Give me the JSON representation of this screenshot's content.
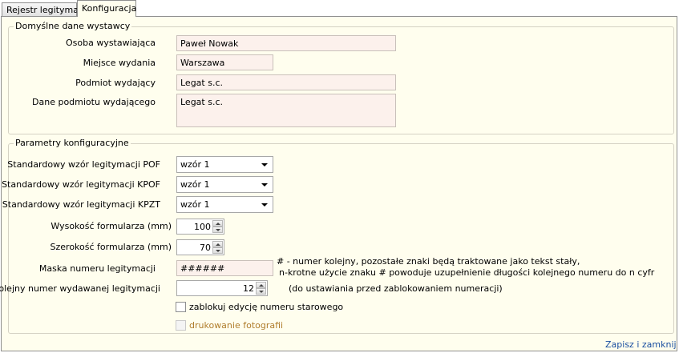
{
  "tabs": [
    {
      "label": "Rejestr legitymacji",
      "active": false
    },
    {
      "label": "Konfiguracja",
      "active": true
    }
  ],
  "issuer": {
    "legend": "Domyślne dane wystawcy",
    "person_label": "Osoba wystawiająca",
    "person_value": "Paweł Nowak",
    "place_label": "Miejsce wydania",
    "place_value": "Warszawa",
    "entity_label": "Podmiot wydający",
    "entity_value": "Legat s.c.",
    "entity_data_label": "Dane podmiotu wydającego",
    "entity_data_value": "Legat s.c."
  },
  "config": {
    "legend": "Parametry konfiguracyjne",
    "pof_label": "Standardowy wzór legitymacji POF",
    "pof_value": "wzór 1",
    "kpof_label": "Standardowy wzór legitymacji KPOF",
    "kpof_value": "wzór 1",
    "kpzt_label": "Standardowy wzór legitymacji KPZT",
    "kpzt_value": "wzór 1",
    "height_label": "Wysokość formularza (mm)",
    "height_value": "100",
    "width_label": "Szerokość formularza (mm)",
    "width_value": "70",
    "mask_label": "Maska numeru legitymacji",
    "mask_value": "######",
    "mask_note_1": "# - numer kolejny, pozostałe znaki będą traktowane jako tekst stały,",
    "mask_note_2": "n-krotne użycie znaku # powoduje uzupełnienie długości kolejnego numeru do n cyfr",
    "next_label": "Kolejny numer wydawanej legitymacji",
    "next_value": "12",
    "next_note": "(do ustawiania przed zablokowaniem numeracji)",
    "lock_label": "zablokuj edycję numeru starowego",
    "lock_checked": false,
    "photo_label": "drukowanie fotografii",
    "photo_checked": false
  },
  "footer": {
    "save_close": "Zapisz i zamknij"
  }
}
